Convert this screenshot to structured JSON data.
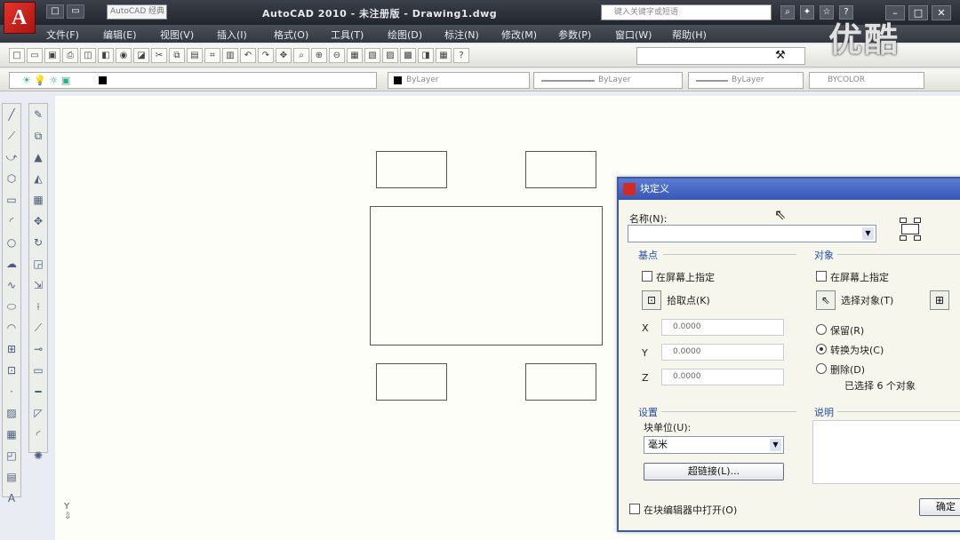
{
  "titlebar": {
    "title": "AutoCAD 2010 - 未注册版 - Drawing1.dwg",
    "workspace": "AutoCAD 经典",
    "search_placeholder": "键入关键字或短语"
  },
  "menu": [
    "文件(F)",
    "编辑(E)",
    "视图(V)",
    "插入(I)",
    "格式(O)",
    "工具(T)",
    "绘图(D)",
    "标注(N)",
    "修改(M)",
    "参数(P)",
    "窗口(W)",
    "帮助(H)"
  ],
  "properties": {
    "color": "ByLayer",
    "linetype": "ByLayer",
    "lineweight": "ByLayer",
    "plotstyle": "BYCOLOR"
  },
  "watermark": "优酷",
  "dialog": {
    "title": "块定义",
    "name_label": "名称(N):",
    "name_value": "",
    "base_point_title": "基点",
    "objects_title": "对象",
    "specify_on_screen": "在屏幕上指定",
    "pick_point": "拾取点(K)",
    "select_objects": "选择对象(T)",
    "x_value": "0.0000",
    "y_value": "0.0000",
    "z_value": "0.0000",
    "retain": "保留(R)",
    "convert_to_block": "转换为块(C)",
    "delete": "删除(D)",
    "selected_count": "已选择 6 个对象",
    "settings_title": "设置",
    "block_unit_label": "块单位(U):",
    "block_unit_value": "毫米",
    "hyperlink": "超链接(L)...",
    "description_title": "说明",
    "open_in_editor": "在块编辑器中打开(O)",
    "ok": "确定"
  },
  "colors": {
    "dialog_title_bg": "#3757b8",
    "canvas_bg": "#fefef8",
    "accent_red": "#d12b22"
  }
}
